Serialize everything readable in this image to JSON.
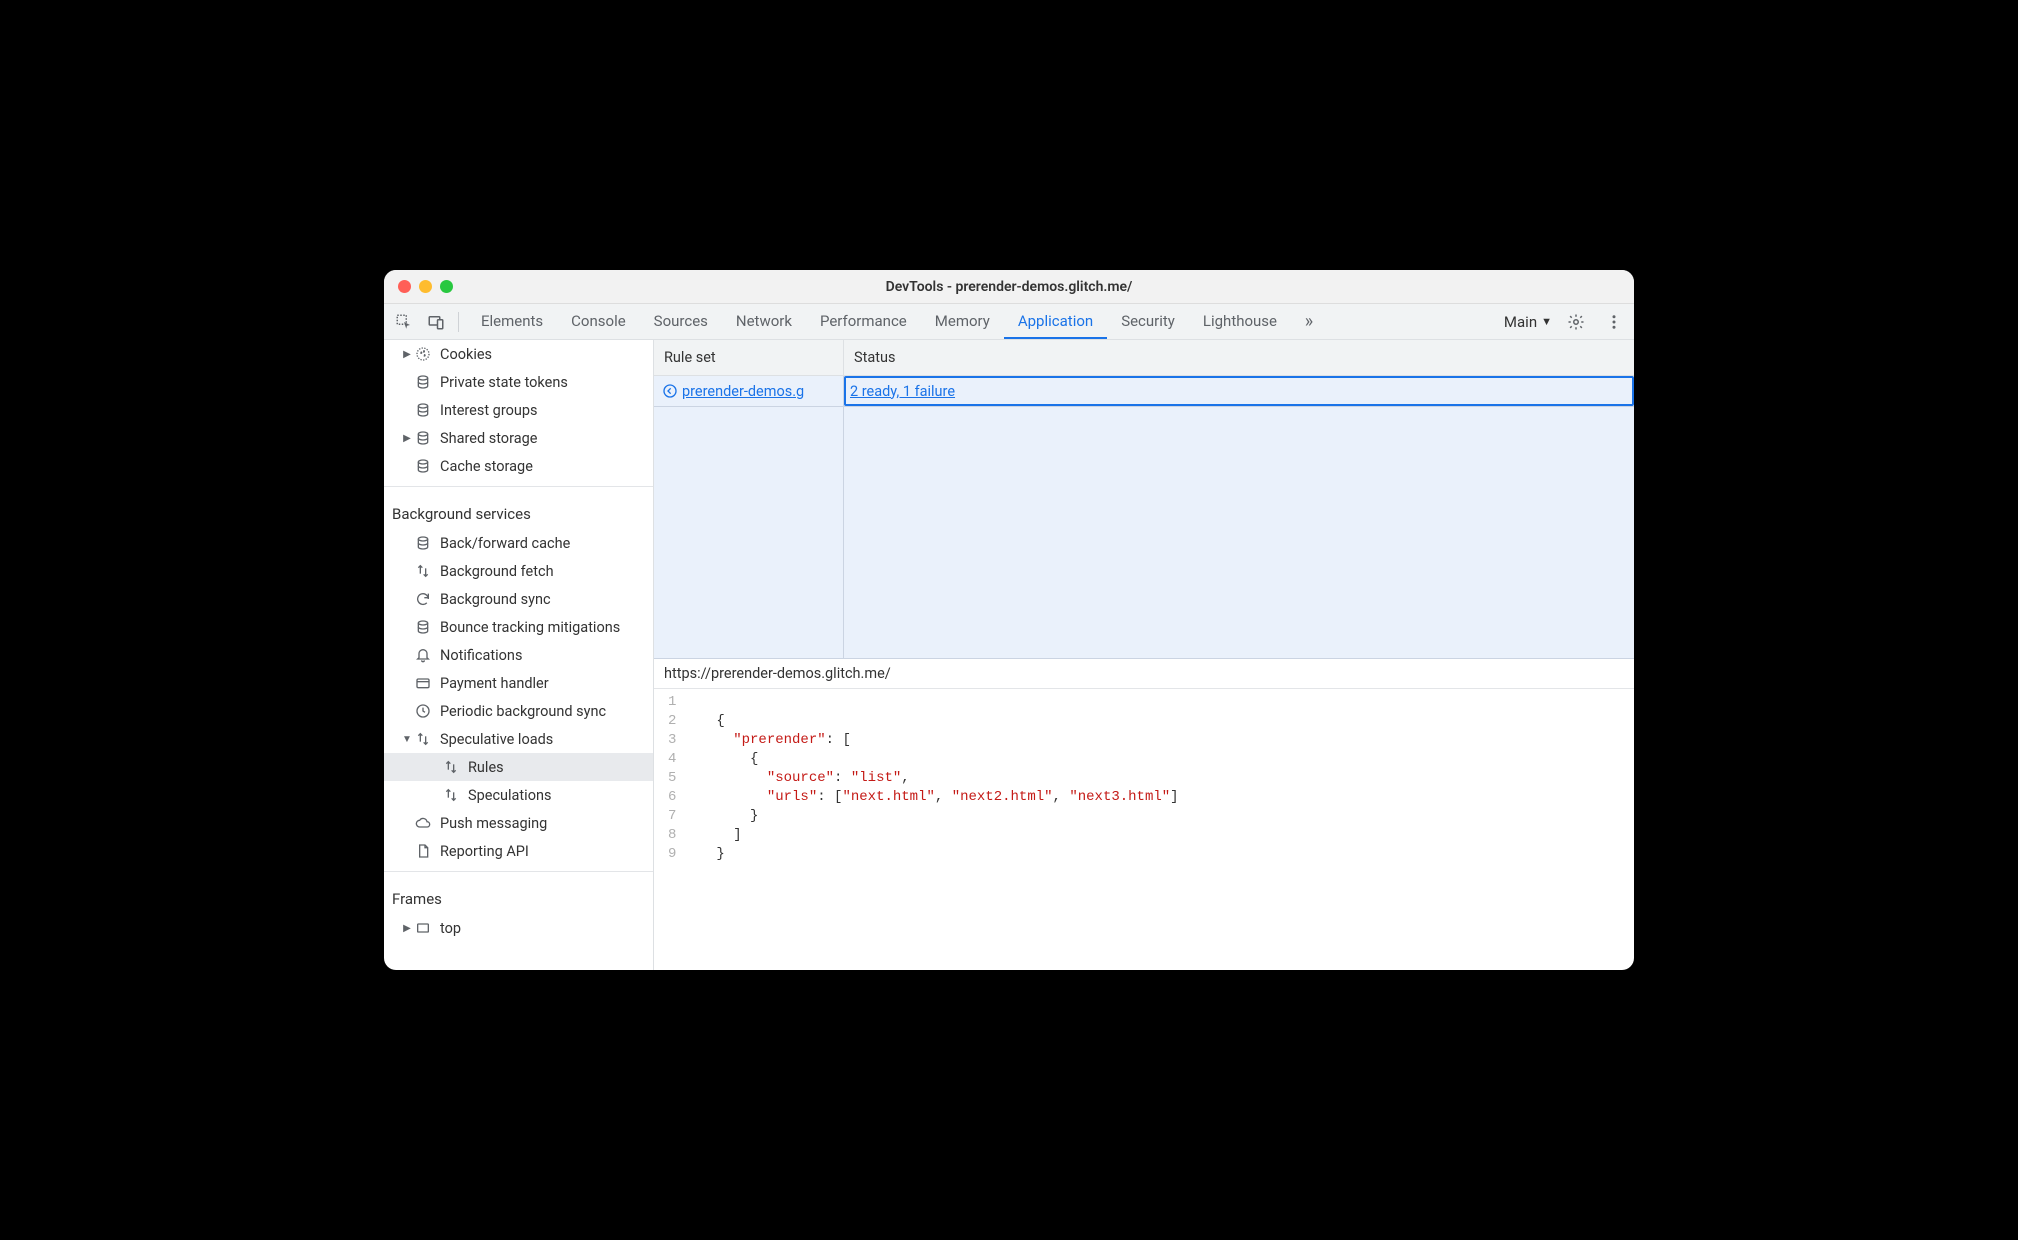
{
  "window": {
    "title": "DevTools - prerender-demos.glitch.me/"
  },
  "toolbar": {
    "tabs": [
      "Elements",
      "Console",
      "Sources",
      "Network",
      "Performance",
      "Memory",
      "Application",
      "Security",
      "Lighthouse"
    ],
    "active": "Application",
    "target": "Main"
  },
  "sidebar": {
    "storage": [
      {
        "label": "Cookies",
        "icon": "cookies",
        "arrow": "right"
      },
      {
        "label": "Private state tokens",
        "icon": "db"
      },
      {
        "label": "Interest groups",
        "icon": "db"
      },
      {
        "label": "Shared storage",
        "icon": "db",
        "arrow": "right"
      },
      {
        "label": "Cache storage",
        "icon": "db"
      }
    ],
    "bg_header": "Background services",
    "bg": [
      {
        "label": "Back/forward cache",
        "icon": "db"
      },
      {
        "label": "Background fetch",
        "icon": "updown"
      },
      {
        "label": "Background sync",
        "icon": "sync"
      },
      {
        "label": "Bounce tracking mitigations",
        "icon": "db"
      },
      {
        "label": "Notifications",
        "icon": "bell"
      },
      {
        "label": "Payment handler",
        "icon": "card"
      },
      {
        "label": "Periodic background sync",
        "icon": "clock"
      },
      {
        "label": "Speculative loads",
        "icon": "updown",
        "arrow": "down",
        "children": [
          {
            "label": "Rules",
            "icon": "updown",
            "selected": true
          },
          {
            "label": "Speculations",
            "icon": "updown"
          }
        ]
      },
      {
        "label": "Push messaging",
        "icon": "cloud"
      },
      {
        "label": "Reporting API",
        "icon": "doc"
      }
    ],
    "frames_header": "Frames",
    "frames": [
      {
        "label": "top",
        "icon": "frame",
        "arrow": "right"
      }
    ]
  },
  "table": {
    "headers": {
      "rule": "Rule set",
      "status": "Status"
    },
    "row": {
      "rule": "prerender-demos.g",
      "status": "2 ready, 1 failure"
    }
  },
  "detail": {
    "url": "https://prerender-demos.glitch.me/",
    "code": {
      "lines": 9,
      "tokens": [
        [],
        [
          {
            "t": "{",
            "c": "punct"
          }
        ],
        [
          {
            "t": "  ",
            "c": "punct"
          },
          {
            "t": "\"prerender\"",
            "c": "key"
          },
          {
            "t": ": [",
            "c": "punct"
          }
        ],
        [
          {
            "t": "    {",
            "c": "punct"
          }
        ],
        [
          {
            "t": "      ",
            "c": "punct"
          },
          {
            "t": "\"source\"",
            "c": "key"
          },
          {
            "t": ": ",
            "c": "punct"
          },
          {
            "t": "\"list\"",
            "c": "str"
          },
          {
            "t": ",",
            "c": "punct"
          }
        ],
        [
          {
            "t": "      ",
            "c": "punct"
          },
          {
            "t": "\"urls\"",
            "c": "key"
          },
          {
            "t": ": [",
            "c": "punct"
          },
          {
            "t": "\"next.html\"",
            "c": "str"
          },
          {
            "t": ", ",
            "c": "punct"
          },
          {
            "t": "\"next2.html\"",
            "c": "str"
          },
          {
            "t": ", ",
            "c": "punct"
          },
          {
            "t": "\"next3.html\"",
            "c": "str"
          },
          {
            "t": "]",
            "c": "punct"
          }
        ],
        [
          {
            "t": "    }",
            "c": "punct"
          }
        ],
        [
          {
            "t": "  ]",
            "c": "punct"
          }
        ],
        [
          {
            "t": "}",
            "c": "punct"
          }
        ]
      ]
    }
  }
}
